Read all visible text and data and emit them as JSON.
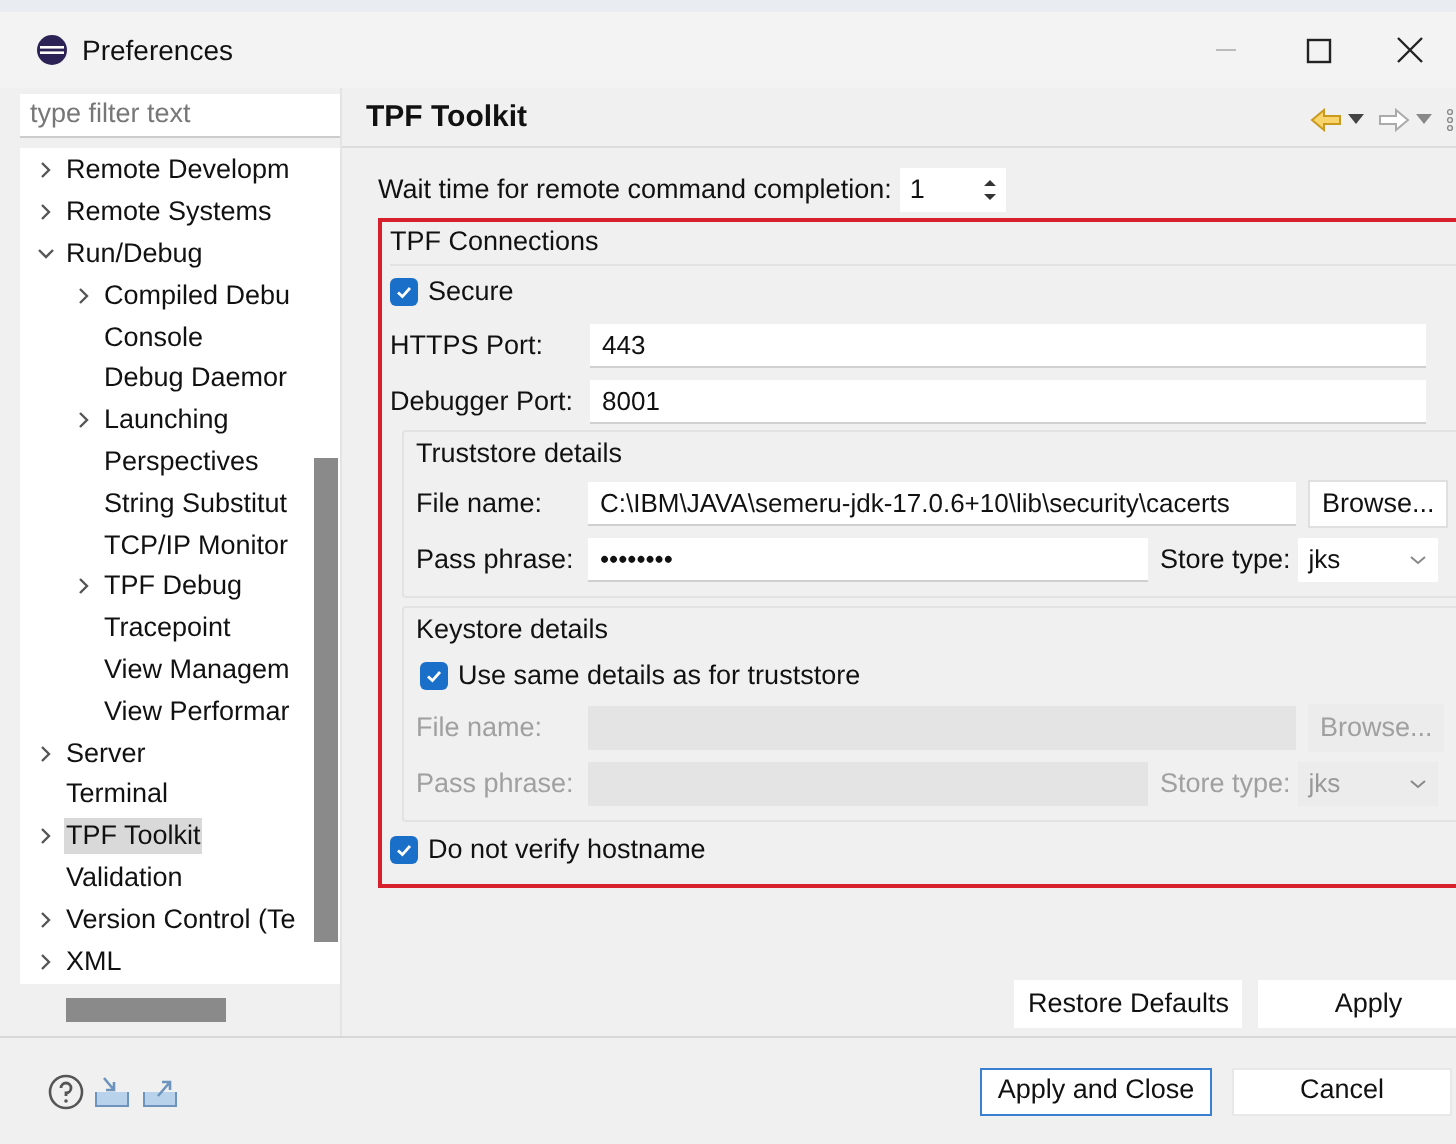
{
  "window": {
    "title": "Preferences"
  },
  "sidebar": {
    "filter": {
      "placeholder": "type filter text"
    },
    "tree": [
      {
        "label": "Remote Developm",
        "kind": "branch",
        "expanded": false,
        "selected": false
      },
      {
        "label": "Remote Systems",
        "kind": "branch",
        "expanded": false,
        "selected": false
      },
      {
        "label": "Run/Debug",
        "kind": "branch",
        "expanded": true,
        "selected": false,
        "children": [
          {
            "label": "Compiled Debu",
            "kind": "branch",
            "expanded": false,
            "selected": false
          },
          {
            "label": "Console",
            "kind": "leaf",
            "selected": false
          },
          {
            "label": "Debug Daemor",
            "kind": "leaf",
            "selected": false
          },
          {
            "label": "Launching",
            "kind": "branch",
            "expanded": false,
            "selected": false
          },
          {
            "label": "Perspectives",
            "kind": "leaf",
            "selected": false
          },
          {
            "label": "String Substitut",
            "kind": "leaf",
            "selected": false
          },
          {
            "label": "TCP/IP Monitor",
            "kind": "leaf",
            "selected": false
          },
          {
            "label": "TPF Debug",
            "kind": "branch",
            "expanded": false,
            "selected": false
          },
          {
            "label": "Tracepoint",
            "kind": "leaf",
            "selected": false
          },
          {
            "label": "View Managem",
            "kind": "leaf",
            "selected": false
          },
          {
            "label": "View Performar",
            "kind": "leaf",
            "selected": false
          }
        ]
      },
      {
        "label": "Server",
        "kind": "branch",
        "expanded": false,
        "selected": false
      },
      {
        "label": "Terminal",
        "kind": "leaf",
        "selected": false
      },
      {
        "label": "TPF Toolkit",
        "kind": "branch",
        "expanded": false,
        "selected": true
      },
      {
        "label": "Validation",
        "kind": "leaf",
        "selected": false
      },
      {
        "label": "Version Control (Te",
        "kind": "branch",
        "expanded": false,
        "selected": false
      },
      {
        "label": "XML",
        "kind": "branch",
        "expanded": false,
        "selected": false
      }
    ]
  },
  "page": {
    "title": "TPF Toolkit",
    "wait_time": {
      "label": "Wait time for remote command completion:",
      "value": "1"
    },
    "connections": {
      "title": "TPF Connections",
      "secure": {
        "label": "Secure",
        "checked": true
      },
      "https_port": {
        "label": "HTTPS Port:",
        "value": "443"
      },
      "debugger_port": {
        "label": "Debugger Port:",
        "value": "8001"
      },
      "truststore": {
        "title": "Truststore details",
        "disabled": false,
        "file_name": {
          "label": "File name:",
          "value": "C:\\IBM\\JAVA\\semeru-jdk-17.0.6+10\\lib\\security\\cacerts"
        },
        "browse": "Browse...",
        "pass_phrase": {
          "label": "Pass phrase:",
          "value": "••••••••"
        },
        "store_type": {
          "label": "Store type:",
          "value": "jks"
        }
      },
      "keystore": {
        "title": "Keystore details",
        "same_as_truststore": {
          "label": "Use same details as for truststore",
          "checked": true
        },
        "disabled": true,
        "file_name": {
          "label": "File name:"
        },
        "browse": "Browse...",
        "pass_phrase": {
          "label": "Pass phrase:"
        },
        "store_type": {
          "label": "Store type:",
          "value": "jks"
        }
      },
      "no_verify_hostname": {
        "label": "Do not verify hostname",
        "checked": true
      }
    },
    "buttons": [
      {
        "label": "Restore Defaults"
      },
      {
        "label": "Apply"
      }
    ]
  },
  "footer": {
    "buttons": [
      {
        "label": "Apply and Close",
        "default": true
      },
      {
        "label": "Cancel",
        "default": false
      }
    ]
  }
}
